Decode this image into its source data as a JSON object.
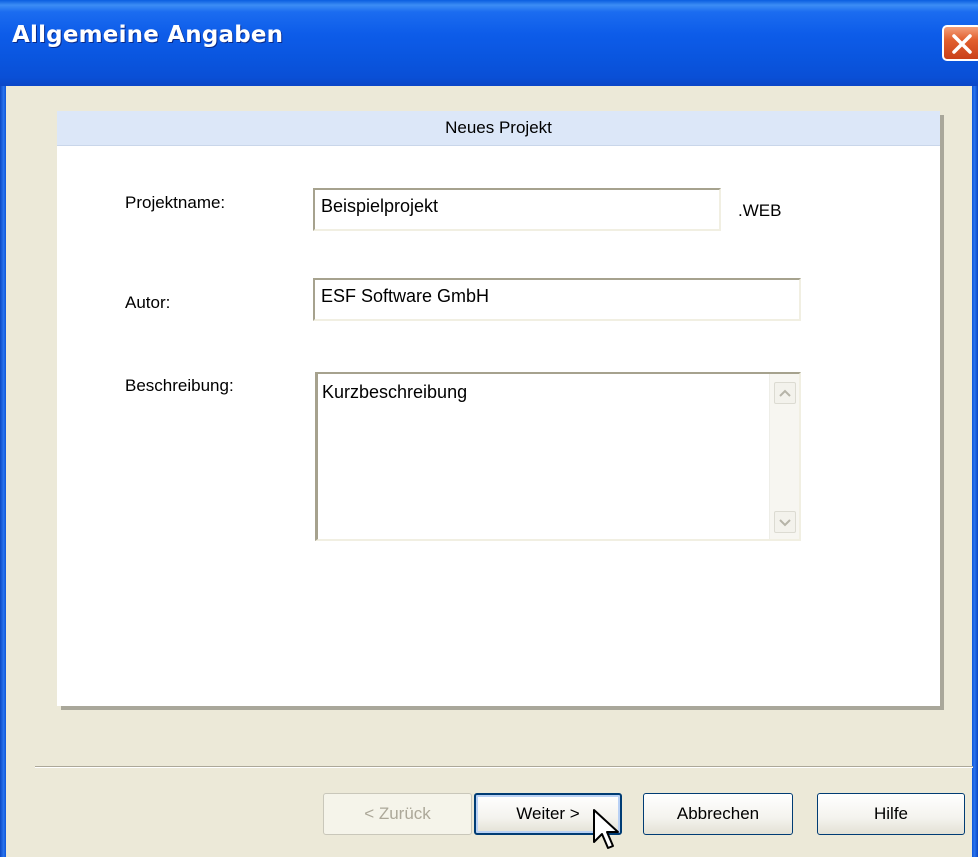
{
  "window": {
    "title": "Allgemeine Angaben"
  },
  "panel": {
    "header": "Neues Projekt"
  },
  "form": {
    "project_name": {
      "label": "Projektname:",
      "value": "Beispielprojekt",
      "suffix": ".WEB"
    },
    "author": {
      "label": "Autor:",
      "value": "ESF Software GmbH"
    },
    "description": {
      "label": "Beschreibung:",
      "value": "Kurzbeschreibung"
    }
  },
  "buttons": {
    "back": "< Zurück",
    "next": "Weiter >",
    "cancel": "Abbrechen",
    "help": "Hilfe"
  },
  "icons": {
    "close": "close-icon",
    "scroll_up": "chevron-up-icon",
    "scroll_down": "chevron-down-icon",
    "cursor": "mouse-cursor-icon"
  },
  "colors": {
    "titlebar": "#0a55de",
    "panel_header": "#dce7f8",
    "close_button": "#e2602f",
    "window_bg": "#ece9d8"
  }
}
